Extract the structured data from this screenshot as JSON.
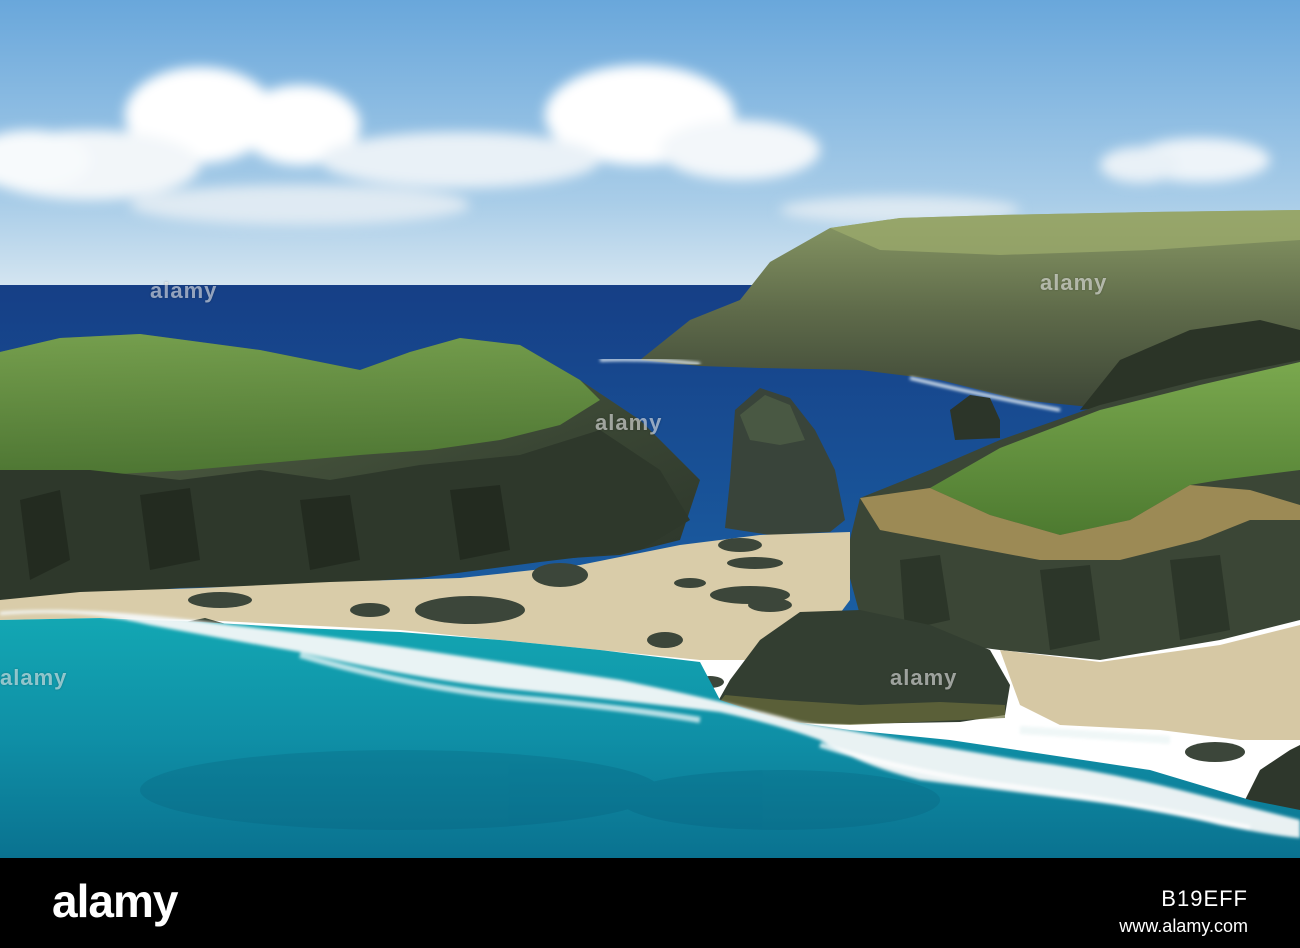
{
  "photo": {
    "watermark_text": "alamy",
    "colors": {
      "sky_top": "#6aa9dc",
      "sky_bottom": "#d7e6f0",
      "deep_sea": "#1c4f91",
      "shallow_sea": "#13a2b0",
      "sand": "#d8cba8",
      "grass": "#5f8a3a",
      "rock": "#2f3a2e"
    }
  },
  "footer": {
    "logo": "alamy",
    "image_id": "B19EFF",
    "url": "www.alamy.com"
  }
}
